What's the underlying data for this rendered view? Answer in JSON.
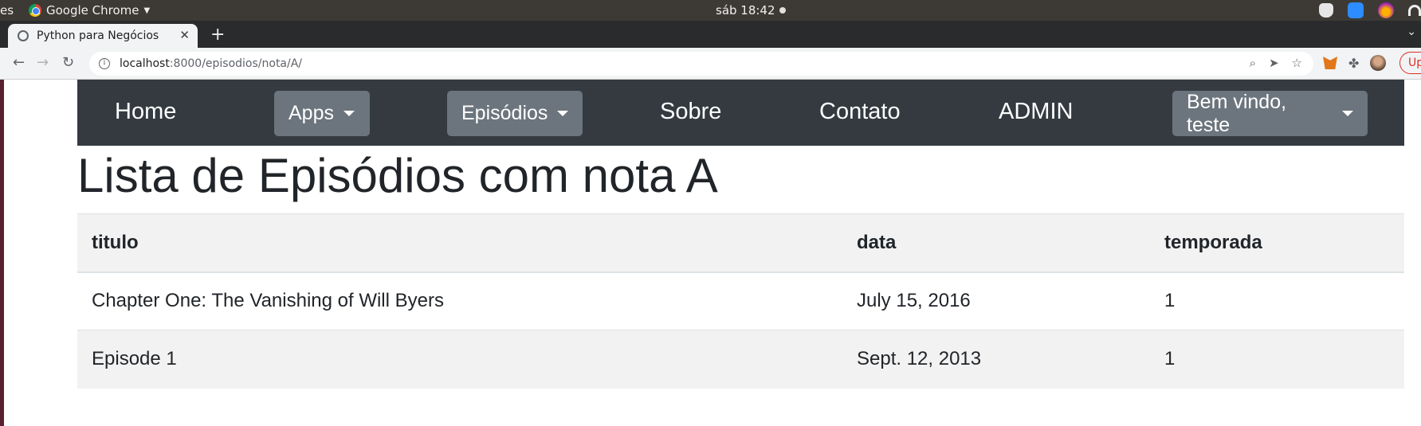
{
  "os": {
    "activities": "es",
    "app_name": "Google Chrome",
    "clock": "sáb 18:42"
  },
  "browser": {
    "tab_title": "Python para Negócios",
    "url_host": "localhost",
    "url_path": ":8000/episodios/nota/A/",
    "update_label": "Up"
  },
  "navbar": {
    "home": "Home",
    "apps": "Apps",
    "episodios": "Episódios",
    "sobre": "Sobre",
    "contato": "Contato",
    "admin": "ADMIN",
    "user_menu": "Bem vindo, teste"
  },
  "page": {
    "title": "Lista de Episódios com nota A"
  },
  "table": {
    "headers": [
      "titulo",
      "data",
      "temporada"
    ],
    "rows": [
      [
        "Chapter One: The Vanishing of Will Byers",
        "July 15, 2016",
        "1"
      ],
      [
        "Episode 1",
        "Sept. 12, 2013",
        "1"
      ]
    ]
  },
  "colors": {
    "navbar_bg": "#343a40",
    "dropdown_bg": "#6c757d",
    "stripe_bg": "#f2f2f2",
    "text": "#212529"
  }
}
